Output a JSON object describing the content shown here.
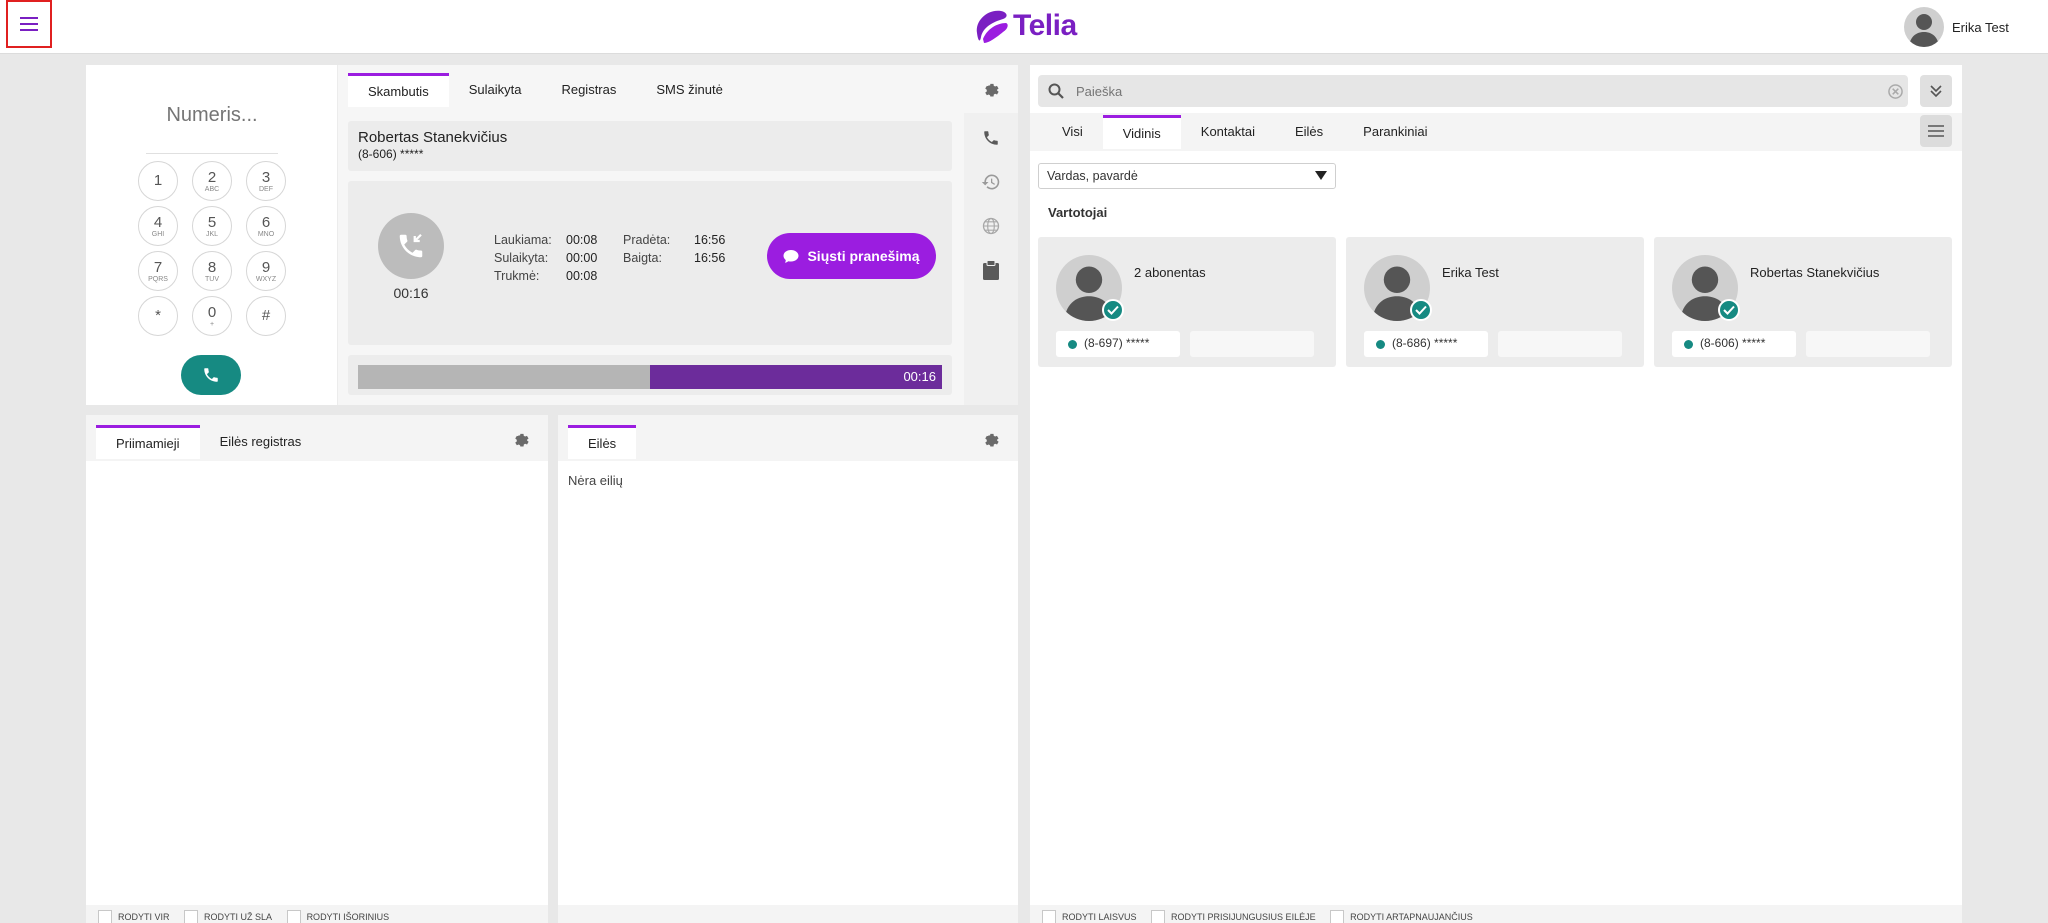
{
  "header": {
    "logo_text": "Telia",
    "user_name": "Erika Test",
    "brand_color": "#9b1de0"
  },
  "dialpad": {
    "placeholder": "Numeris...",
    "keys": [
      {
        "digit": "1",
        "letters": ""
      },
      {
        "digit": "2",
        "letters": "ABC"
      },
      {
        "digit": "3",
        "letters": "DEF"
      },
      {
        "digit": "4",
        "letters": "GHI"
      },
      {
        "digit": "5",
        "letters": "JKL"
      },
      {
        "digit": "6",
        "letters": "MNO"
      },
      {
        "digit": "7",
        "letters": "PQRS"
      },
      {
        "digit": "8",
        "letters": "TUV"
      },
      {
        "digit": "9",
        "letters": "WXYZ"
      },
      {
        "digit": "*",
        "letters": ""
      },
      {
        "digit": "0",
        "letters": "+"
      },
      {
        "digit": "#",
        "letters": ""
      }
    ]
  },
  "call": {
    "tabs": [
      "Skambutis",
      "Sulaikyta",
      "Registras",
      "SMS žinutė"
    ],
    "active_tab": 0,
    "contact_name": "Robertas Stanekvičius",
    "contact_number": "(8-606) *****",
    "timer": "00:16",
    "stats": {
      "waiting_label": "Laukiama:",
      "waiting_value": "00:08",
      "held_label": "Sulaikyta:",
      "held_value": "00:00",
      "duration_label": "Trukmė:",
      "duration_value": "00:08",
      "started_label": "Pradėta:",
      "started_value": "16:56",
      "ended_label": "Baigta:",
      "ended_value": "16:56"
    },
    "send_message_label": "Siųsti pranešimą",
    "progress_time": "00:16",
    "progress_fraction": 0.5
  },
  "directory": {
    "search_placeholder": "Paieška",
    "tabs": [
      "Visi",
      "Vidinis",
      "Kontaktai",
      "Eilės",
      "Parankiniai"
    ],
    "active_tab": 1,
    "sort_value": "Vardas, pavardė",
    "users_heading": "Vartotojai",
    "users": [
      {
        "name": "2 abonentas",
        "phone": "(8-697) *****"
      },
      {
        "name": "Erika Test",
        "phone": "(8-686) *****"
      },
      {
        "name": "Robertas Stanekvičius",
        "phone": "(8-606) *****"
      }
    ],
    "footer": [
      "RODYTI LAISVUS",
      "RODYTI PRISIJUNGUSIUS EILĖJE",
      "RODYTI ARTAPNAUJANČIUS"
    ]
  },
  "incoming": {
    "tabs": [
      "Priimamieji",
      "Eilės registras"
    ],
    "active_tab": 0,
    "footer": [
      "RODYTI VIR",
      "RODYTI UŽ SLA",
      "RODYTI IŠORINIUS"
    ]
  },
  "queues": {
    "tabs": [
      "Eilės"
    ],
    "active_tab": 0,
    "empty_text": "Nėra eilių"
  }
}
